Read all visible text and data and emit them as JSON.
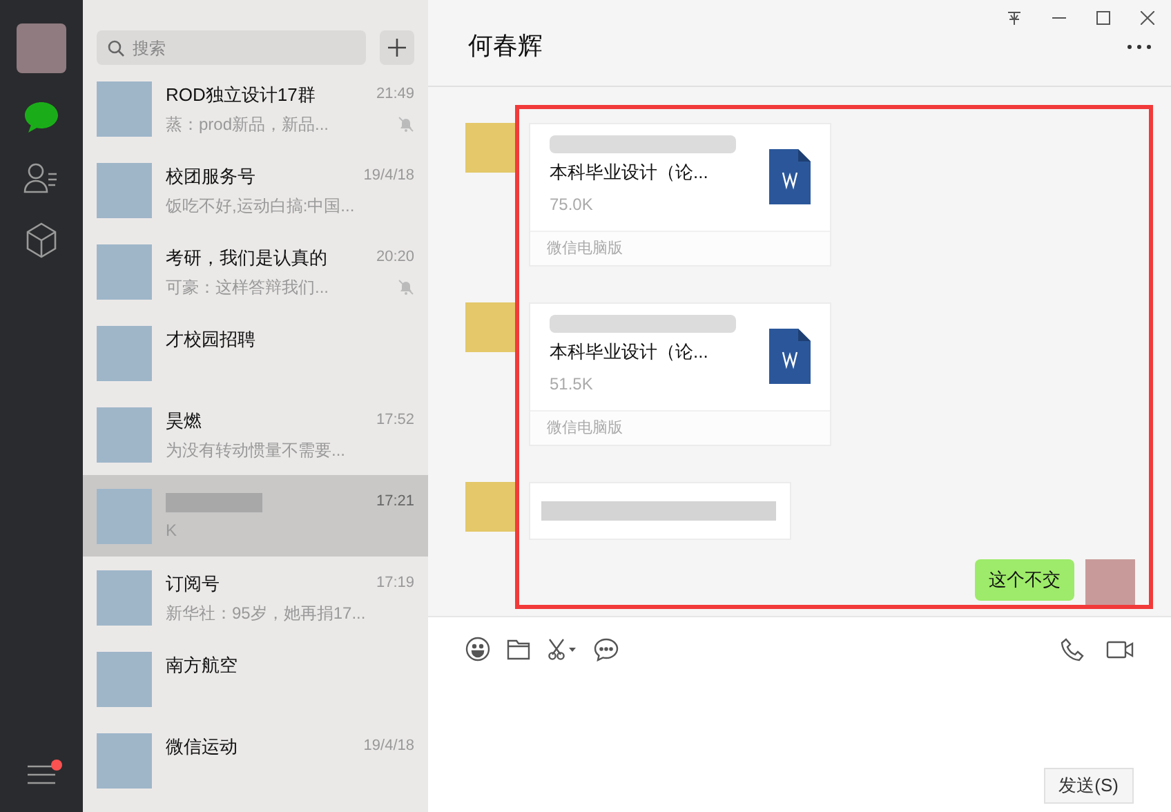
{
  "search": {
    "placeholder": "搜索"
  },
  "chats": [
    {
      "title": "ROD独立设计17群",
      "time": "21:49",
      "preview": "蒸：prod新品，新品...",
      "muted": true,
      "selected": false
    },
    {
      "title": "校团服务号",
      "time": "19/4/18",
      "preview": "饭吃不好,运动白搞:中国...",
      "muted": false,
      "selected": false
    },
    {
      "title": "考研，我们是认真的",
      "time": "20:20",
      "preview": "可豪：这样答辩我们...",
      "muted": true,
      "selected": false
    },
    {
      "title": "才校园招聘",
      "muted": false,
      "selected": false
    },
    {
      "title": "昊燃",
      "time": "17:52",
      "preview": "为没有转动惯量不需要...",
      "muted": false,
      "selected": false
    },
    {
      "time": "17:21",
      "preview": "K",
      "muted": false,
      "selected": true
    },
    {
      "title": "订阅号",
      "time": "17:19",
      "preview": "新华社：95岁，她再捐17...",
      "muted": false,
      "selected": false
    },
    {
      "title": "南方航空",
      "muted": false,
      "selected": false
    },
    {
      "title": "微信运动",
      "time": "19/4/18",
      "muted": false,
      "selected": false
    }
  ],
  "chat": {
    "title": "何春辉",
    "messages": [
      {
        "kind": "file",
        "filename": "本科毕业设计（论...",
        "size": "75.0K",
        "source": "微信电脑版"
      },
      {
        "kind": "file",
        "filename": "本科毕业设计（论...",
        "size": "51.5K",
        "source": "微信电脑版"
      },
      {
        "kind": "blurred"
      },
      {
        "kind": "sent",
        "text": "这个不交"
      }
    ],
    "send_button": "发送(S)"
  }
}
